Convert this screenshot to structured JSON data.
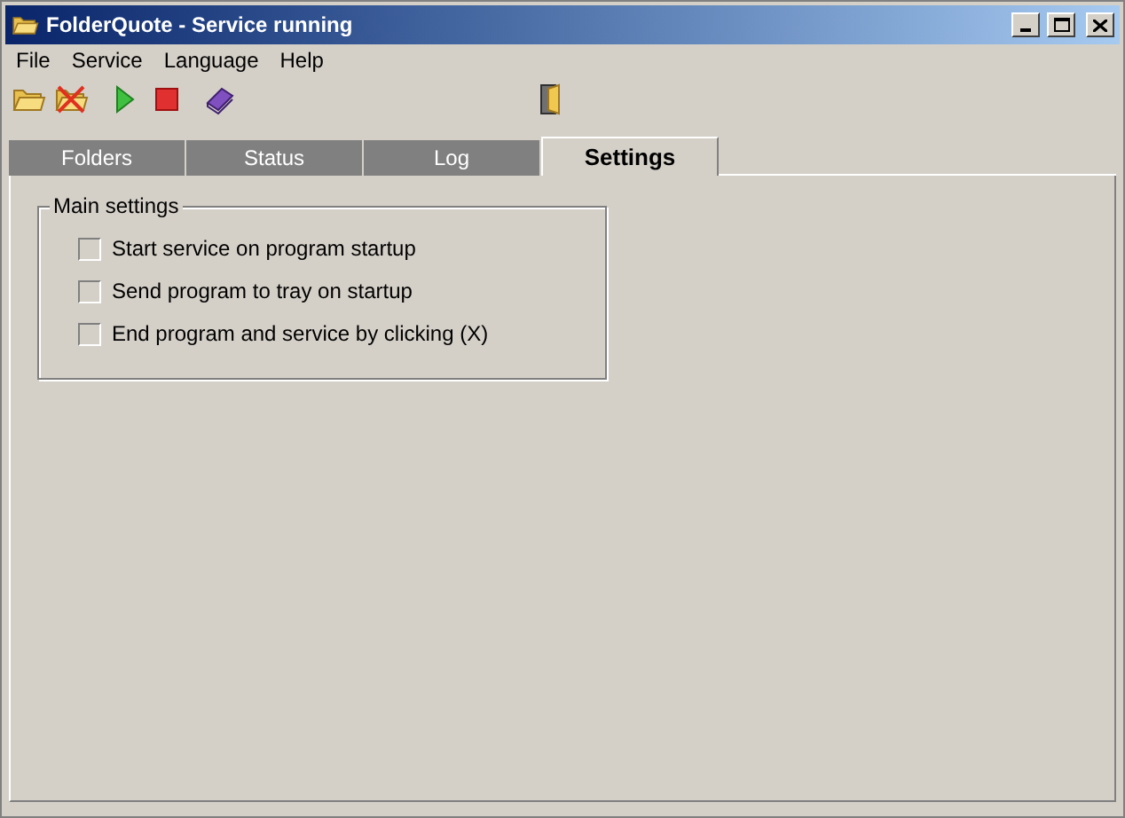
{
  "window": {
    "title": "FolderQuote - Service running"
  },
  "menu": [
    "File",
    "Service",
    "Language",
    "Help"
  ],
  "tabs": [
    {
      "label": "Folders",
      "selected": false
    },
    {
      "label": "Status",
      "selected": false
    },
    {
      "label": "Log",
      "selected": false
    },
    {
      "label": "Settings",
      "selected": true
    }
  ],
  "main_settings": {
    "title": "Main settings",
    "options": [
      {
        "label": "Start service on program startup",
        "checked": false,
        "disabled": true
      },
      {
        "label": "Send program to tray on startup",
        "checked": false,
        "disabled": true
      },
      {
        "label": "End program and service by clicking (X)",
        "checked": false,
        "disabled": true
      }
    ]
  }
}
